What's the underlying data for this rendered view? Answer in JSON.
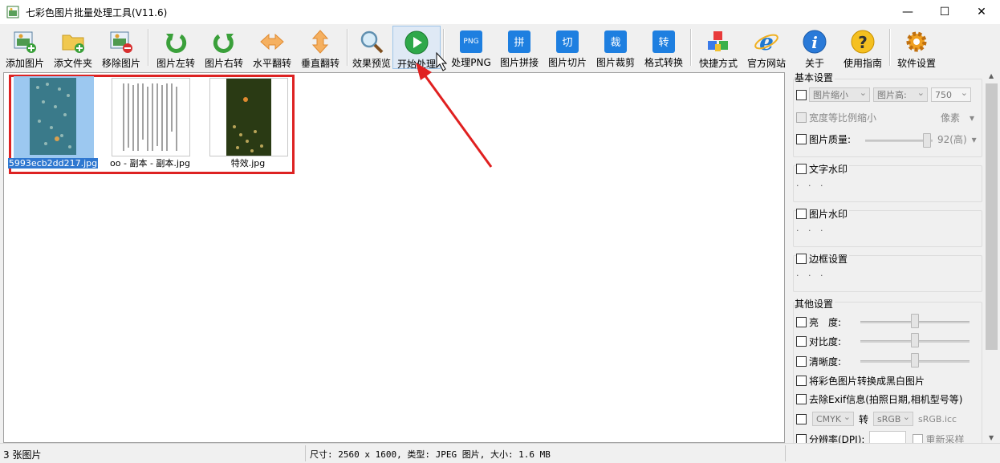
{
  "window": {
    "title": "七彩色图片批量处理工具(V11.6)",
    "minimize": "—",
    "maximize": "☐",
    "close": "✕"
  },
  "toolbar": [
    {
      "id": "add-image",
      "label": "添加图片",
      "icon": "add-image-icon"
    },
    {
      "id": "add-folder",
      "label": "添文件夹",
      "icon": "add-folder-icon"
    },
    {
      "id": "remove-image",
      "label": "移除图片",
      "icon": "remove-image-icon"
    },
    {
      "id": "rotate-left",
      "label": "图片左转",
      "icon": "rotate-left-icon"
    },
    {
      "id": "rotate-right",
      "label": "图片右转",
      "icon": "rotate-right-icon"
    },
    {
      "id": "flip-horizontal",
      "label": "水平翻转",
      "icon": "flip-horizontal-icon"
    },
    {
      "id": "flip-vertical",
      "label": "垂直翻转",
      "icon": "flip-vertical-icon"
    },
    {
      "id": "preview",
      "label": "效果预览",
      "icon": "magnifier-icon"
    },
    {
      "id": "start",
      "label": "开始处理",
      "icon": "play-icon"
    },
    {
      "id": "process-png",
      "label": "处理PNG",
      "icon": "png-icon",
      "badge": "PNG"
    },
    {
      "id": "stitch",
      "label": "图片拼接",
      "icon": "stitch-icon",
      "badge": "拼"
    },
    {
      "id": "slice",
      "label": "图片切片",
      "icon": "slice-icon",
      "badge": "切"
    },
    {
      "id": "crop",
      "label": "图片裁剪",
      "icon": "crop-icon",
      "badge": "裁"
    },
    {
      "id": "convert",
      "label": "格式转换",
      "icon": "convert-icon",
      "badge": "转"
    },
    {
      "id": "shortcut",
      "label": "快捷方式",
      "icon": "cubes-icon"
    },
    {
      "id": "website",
      "label": "官方网站",
      "icon": "ie-icon"
    },
    {
      "id": "about",
      "label": "关于",
      "icon": "info-icon"
    },
    {
      "id": "guide",
      "label": "使用指南",
      "icon": "help-icon"
    },
    {
      "id": "settings",
      "label": "软件设置",
      "icon": "gear-icon"
    }
  ],
  "files": [
    {
      "name": "5993ecb2dd217.jpg",
      "selected": true
    },
    {
      "name": "oo - 副本 - 副本.jpg",
      "selected": false
    },
    {
      "name": "特效.jpg",
      "selected": false
    }
  ],
  "panel": {
    "basic": {
      "title": "基本设置",
      "resize_label": "图片缩小",
      "height_label": "图片高:",
      "height_value": "750",
      "keep_ratio": "宽度等比例缩小",
      "unit": "像素",
      "quality_label": "图片质量:",
      "quality_value": "92(高)",
      "quality_level": 0.92
    },
    "text_watermark": "文字水印",
    "image_watermark": "图片水印",
    "border": "边框设置",
    "dots": ". . .",
    "other": {
      "title": "其他设置",
      "brightness": "亮　度:",
      "contrast": "对比度:",
      "sharpness": "清晰度:",
      "grayscale": "将彩色图片转换成黑白图片",
      "remove_exif": "去除Exif信息(拍照日期,相机型号等)",
      "color_from": "CMYK",
      "convert_label": "转",
      "color_to": "sRGB",
      "icc": "sRGB.icc",
      "dpi": "分辨率(DPI):",
      "resample": "重新采样"
    }
  },
  "status": {
    "count": "3 张图片",
    "info": "尺寸: 2560 x 1600, 类型: JPEG 图片, 大小: 1.6 MB"
  }
}
